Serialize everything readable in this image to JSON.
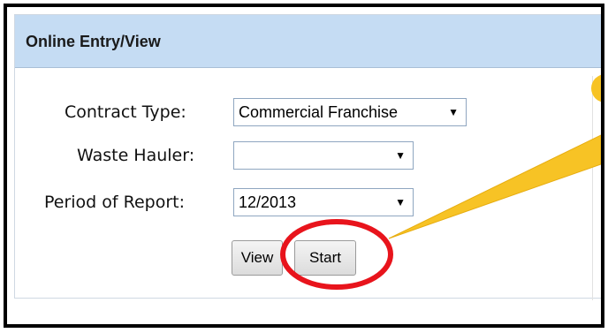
{
  "panel": {
    "title": "Online Entry/View"
  },
  "form": {
    "contract_type": {
      "label": "Contract Type:",
      "value": "Commercial Franchise"
    },
    "waste_hauler": {
      "label": "Waste Hauler:",
      "value": ""
    },
    "period_of_report": {
      "label": "Period of Report:",
      "value": "12/2013"
    }
  },
  "buttons": {
    "view_label": "View",
    "start_label": "Start"
  },
  "annotation": {
    "highlight_color": "#e8141c",
    "callout_color": "#f7c325"
  }
}
